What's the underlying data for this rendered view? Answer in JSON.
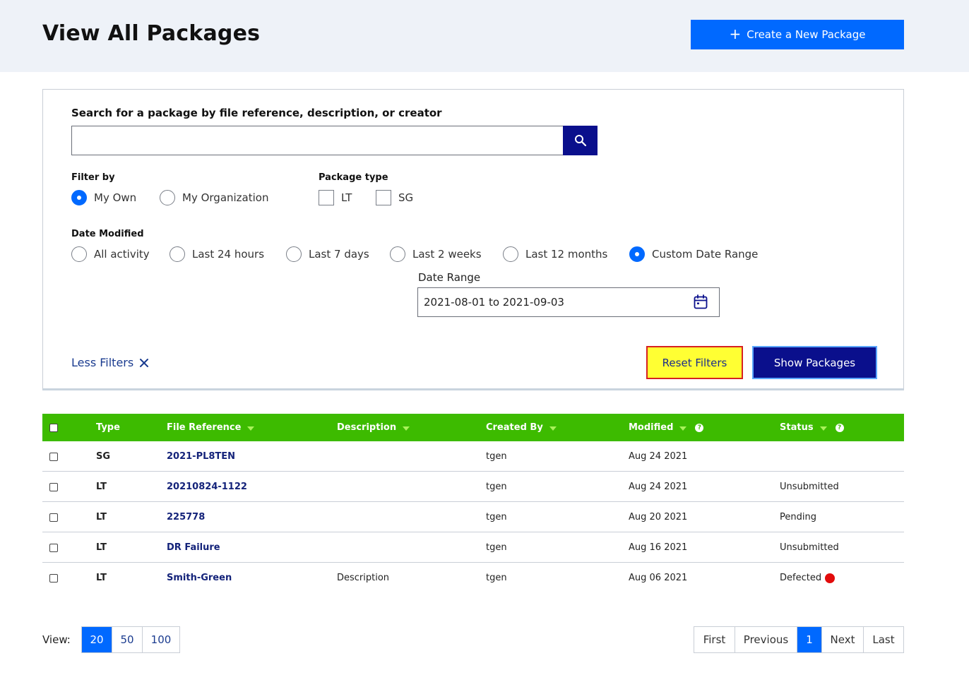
{
  "header": {
    "title": "View All Packages",
    "create_button_label": "Create a New Package"
  },
  "search": {
    "label": "Search for a package by file reference, description, or creator",
    "value": "",
    "placeholder": ""
  },
  "filter_by": {
    "label": "Filter by",
    "options": [
      "My Own",
      "My Organization"
    ],
    "selected": "My Own"
  },
  "package_type": {
    "label": "Package type",
    "options": [
      "LT",
      "SG"
    ]
  },
  "date_modified": {
    "label": "Date Modified",
    "options": [
      "All activity",
      "Last 24 hours",
      "Last 7 days",
      "Last 2 weeks",
      "Last 12 months",
      "Custom Date Range"
    ],
    "selected": "Custom Date Range"
  },
  "date_range": {
    "label": "Date Range",
    "value": "2021-08-01 to 2021-09-03"
  },
  "actions": {
    "less_filters": "Less Filters",
    "reset": "Reset Filters",
    "show": "Show Packages"
  },
  "table": {
    "columns": [
      "Type",
      "File Reference",
      "Description",
      "Created By",
      "Modified",
      "Status"
    ],
    "rows": [
      {
        "type": "SG",
        "ref": "2021-PL8TEN",
        "description": "",
        "created_by": "tgen",
        "modified": "Aug 24 2021",
        "status": ""
      },
      {
        "type": "LT",
        "ref": "20210824-1122",
        "description": "",
        "created_by": "tgen",
        "modified": "Aug 24 2021",
        "status": "Unsubmitted"
      },
      {
        "type": "LT",
        "ref": "225778",
        "description": "",
        "created_by": "tgen",
        "modified": "Aug 20 2021",
        "status": "Pending"
      },
      {
        "type": "LT",
        "ref": "DR Failure",
        "description": "",
        "created_by": "tgen",
        "modified": "Aug 16 2021",
        "status": "Unsubmitted"
      },
      {
        "type": "LT",
        "ref": "Smith-Green",
        "description": "Description",
        "created_by": "tgen",
        "modified": "Aug 06 2021",
        "status": "Defected"
      }
    ]
  },
  "pagination": {
    "view_label": "View:",
    "page_sizes": [
      "20",
      "50",
      "100"
    ],
    "selected_size": "20",
    "first": "First",
    "previous": "Previous",
    "current": "1",
    "next": "Next",
    "last": "Last"
  },
  "colors": {
    "primary": "#0069ff",
    "navy": "#0a0f8c",
    "table_header": "#3dbb00",
    "header_bg": "#eef2f8",
    "defect_dot": "#e20b0b",
    "highlight": "#ffff33"
  }
}
